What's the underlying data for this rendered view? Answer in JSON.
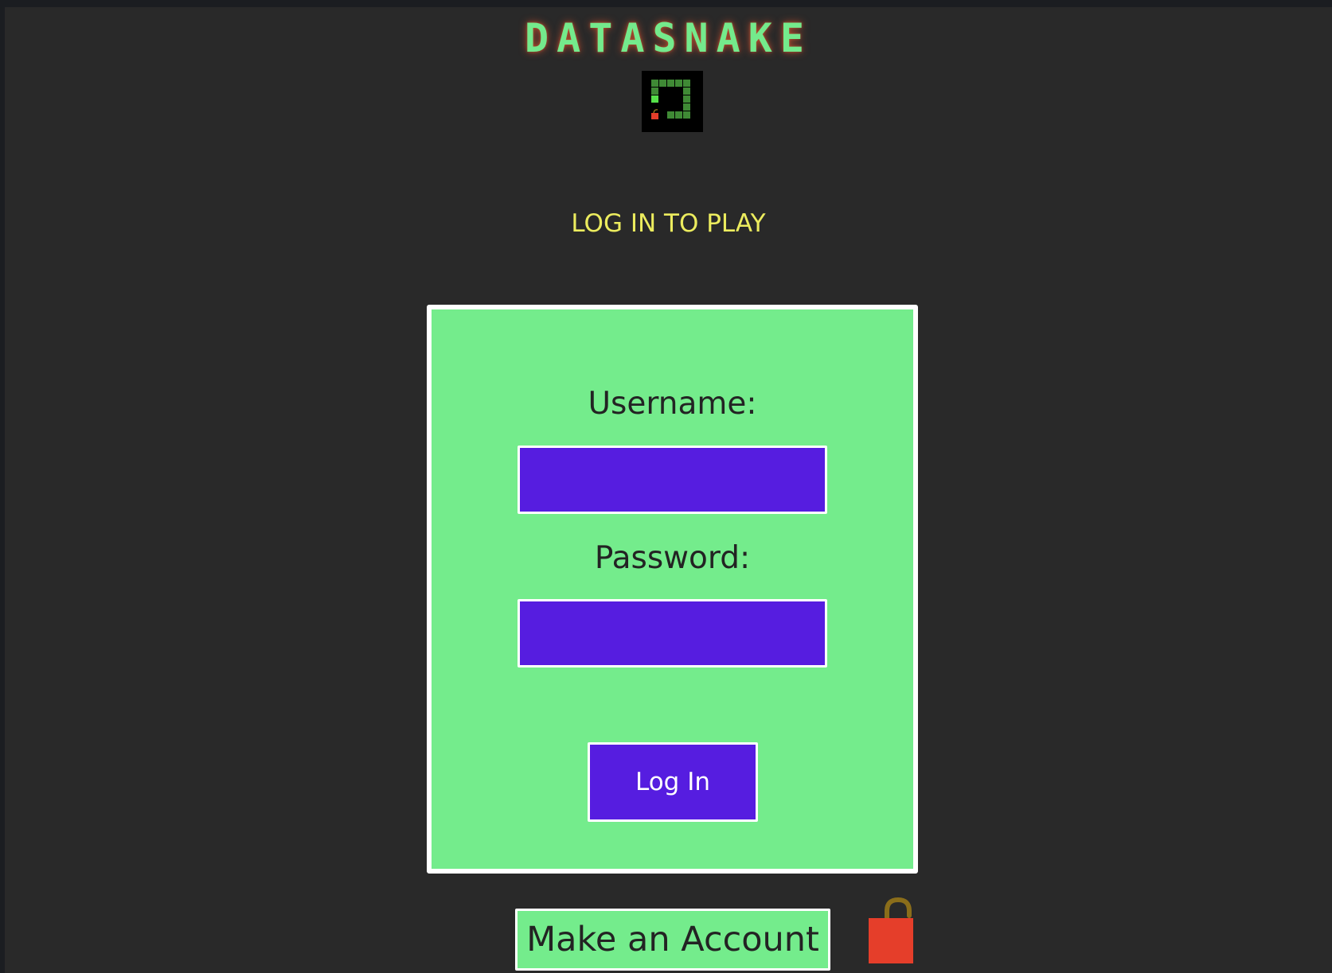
{
  "app": {
    "title": "DATASNAKE",
    "logo_icon": "snake-game-icon"
  },
  "subtitle": "LOG IN TO PLAY",
  "login_form": {
    "username_label": "Username:",
    "username_value": "",
    "password_label": "Password:",
    "password_value": "",
    "submit_label": "Log In"
  },
  "footer": {
    "make_account_label": "Make an Account",
    "lock_icon": "unlocked-padlock-icon"
  },
  "colors": {
    "page_background": "#292929",
    "title_green": "#74ea8c",
    "title_glow": "#e85a32",
    "subtitle_yellow": "#ecec5e",
    "panel_green": "#74ec8c",
    "input_purple": "#561de0",
    "lock_red": "#e53e2a",
    "lock_shackle": "#8a6d1a"
  }
}
